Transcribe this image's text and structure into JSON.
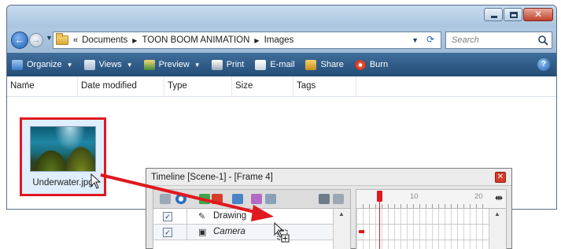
{
  "explorer": {
    "breadcrumb": [
      "Documents",
      "TOON BOOM ANIMATION",
      "Images"
    ],
    "crumb_prefix": "«",
    "search_placeholder": "Search",
    "toolbar": {
      "organize": "Organize",
      "views": "Views",
      "preview": "Preview",
      "print": "Print",
      "email": "E-mail",
      "share": "Share",
      "burn": "Burn"
    },
    "columns": [
      "Name",
      "Date modified",
      "Type",
      "Size",
      "Tags"
    ],
    "file": {
      "name": "Underwater.jpg",
      "thumbnail": "underwater-thumbnail"
    }
  },
  "timeline": {
    "title": "Timeline [Scene-1] - [Frame 4]",
    "layers": [
      {
        "name": "Drawing",
        "checked": true,
        "icon": "drawing-layer-icon"
      },
      {
        "name": "Camera",
        "checked": true,
        "icon": "camera-layer-icon"
      }
    ],
    "ruler_labels": [
      "10",
      "20"
    ],
    "current_frame": 4
  },
  "colors": {
    "highlight_red": "#e0191f",
    "toolbar_blue": "#2f5c89"
  }
}
